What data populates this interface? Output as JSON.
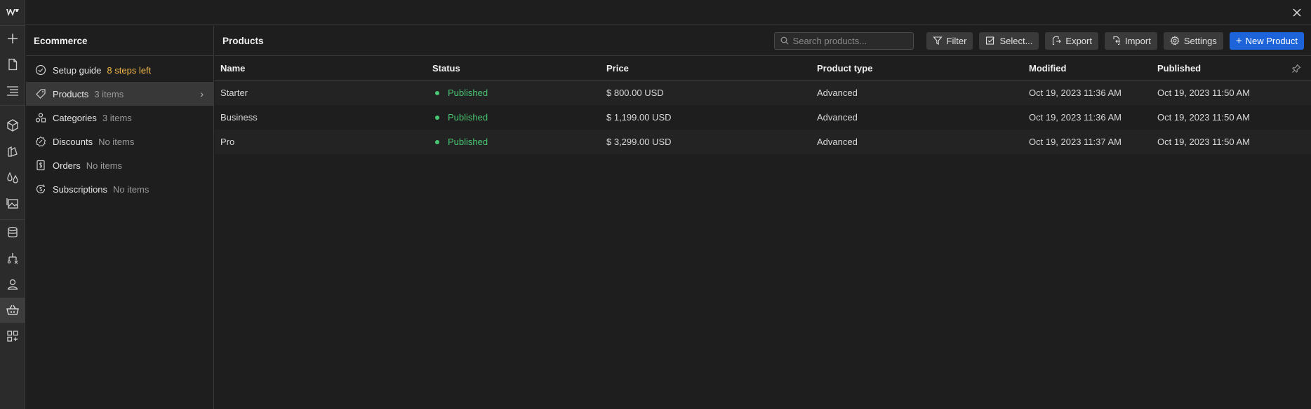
{
  "colors": {
    "accent": "#1d63d9",
    "published": "#48c774",
    "warning": "#f2b84b"
  },
  "rail": {
    "logo": "webflow-logo",
    "icons": [
      "add-icon",
      "page-icon",
      "navigator-icon",
      "components-icon",
      "style-guide-icon",
      "variables-icon",
      "assets-icon",
      "cms-icon",
      "logic-icon",
      "users-icon",
      "ecommerce-icon",
      "apps-icon"
    ]
  },
  "sidebar": {
    "title": "Ecommerce",
    "items": [
      {
        "label": "Setup guide",
        "count": "8 steps left",
        "icon": "check-circle-icon"
      },
      {
        "label": "Products",
        "count": "3 items",
        "icon": "tag-icon"
      },
      {
        "label": "Categories",
        "count": "3 items",
        "icon": "shapes-icon"
      },
      {
        "label": "Discounts",
        "count": "No items",
        "icon": "discount-icon"
      },
      {
        "label": "Orders",
        "count": "No items",
        "icon": "receipt-icon"
      },
      {
        "label": "Subscriptions",
        "count": "No items",
        "icon": "subscription-icon"
      }
    ]
  },
  "main": {
    "title": "Products",
    "search_placeholder": "Search products...",
    "buttons": {
      "filter": "Filter",
      "select": "Select...",
      "export": "Export",
      "import": "Import",
      "settings": "Settings",
      "new_product": "New Product"
    }
  },
  "table": {
    "headers": {
      "name": "Name",
      "status": "Status",
      "price": "Price",
      "type": "Product type",
      "modified": "Modified",
      "published": "Published"
    },
    "rows": [
      {
        "name": "Starter",
        "status": "Published",
        "price": "$ 800.00 USD",
        "type": "Advanced",
        "modified": "Oct 19, 2023 11:36 AM",
        "published": "Oct 19, 2023 11:50 AM"
      },
      {
        "name": "Business",
        "status": "Published",
        "price": "$ 1,199.00 USD",
        "type": "Advanced",
        "modified": "Oct 19, 2023 11:36 AM",
        "published": "Oct 19, 2023 11:50 AM"
      },
      {
        "name": "Pro",
        "status": "Published",
        "price": "$ 3,299.00 USD",
        "type": "Advanced",
        "modified": "Oct 19, 2023 11:37 AM",
        "published": "Oct 19, 2023 11:50 AM"
      }
    ]
  }
}
